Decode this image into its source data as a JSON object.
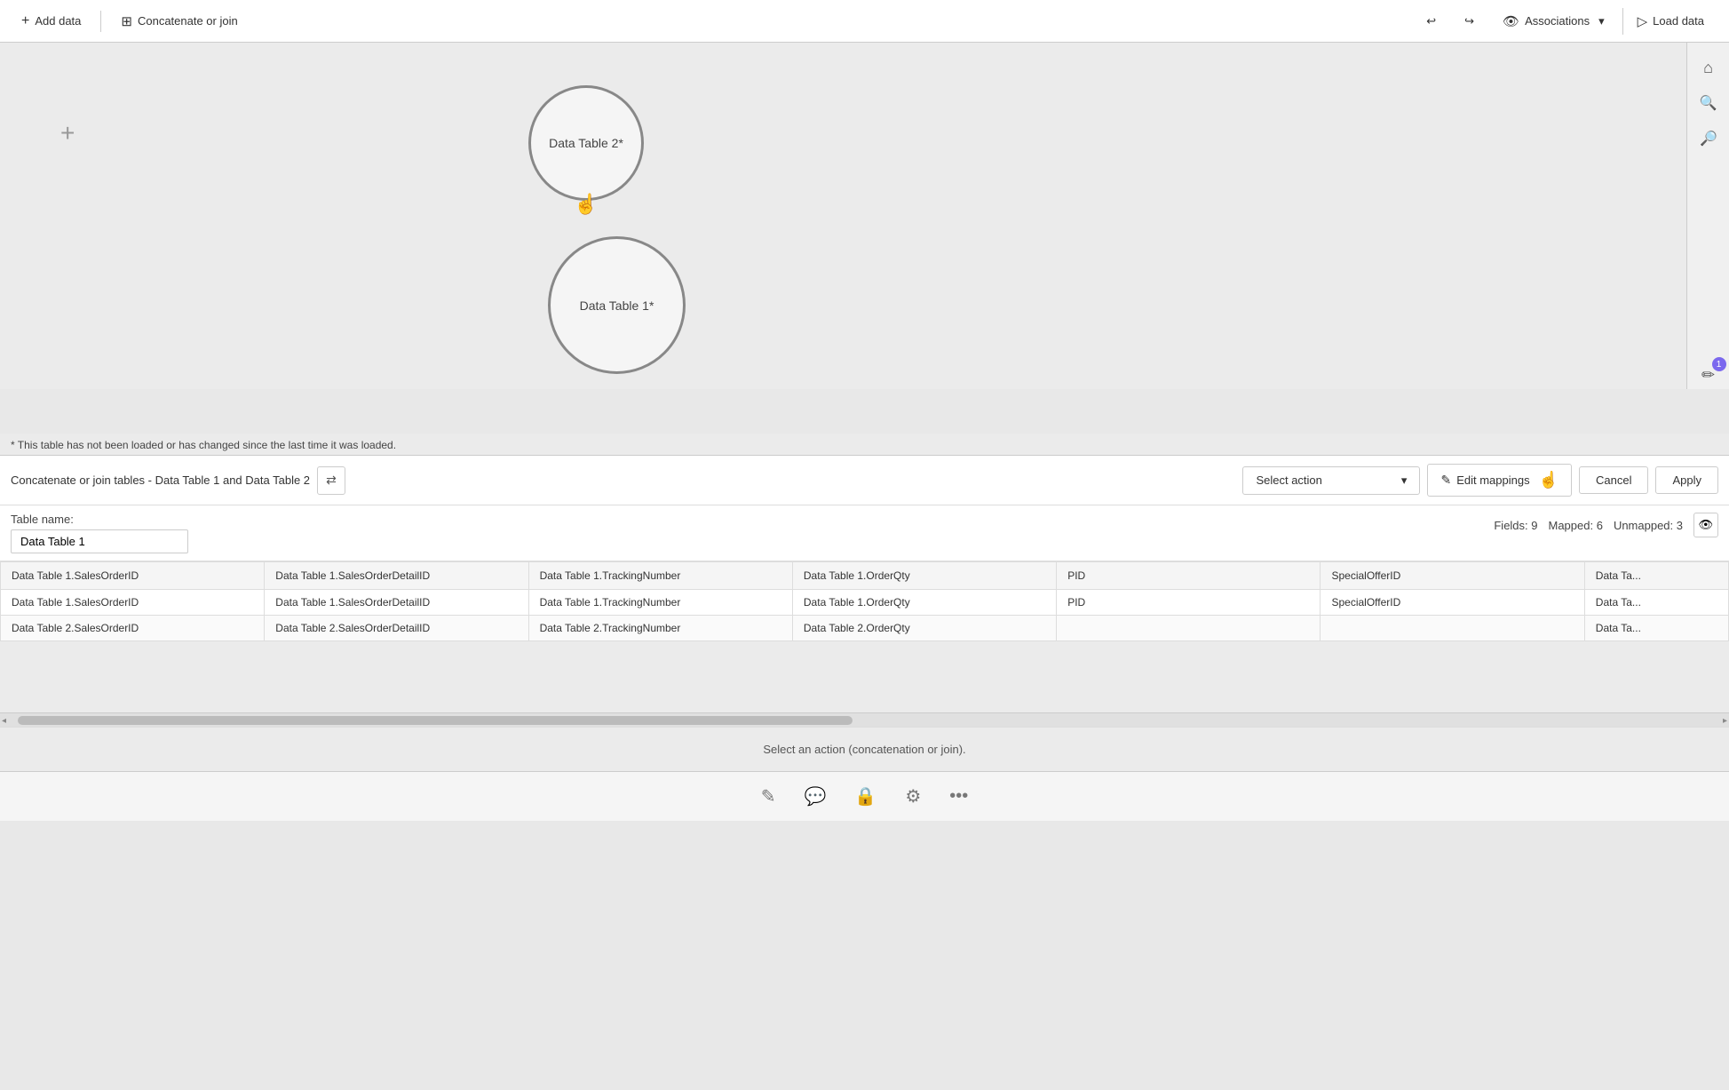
{
  "toolbar": {
    "add_data_label": "Add data",
    "concatenate_join_label": "Concatenate or join",
    "associations_label": "Associations",
    "load_data_label": "Load data",
    "undo_icon": "↩",
    "redo_icon": "↪",
    "chevron_down": "▾"
  },
  "canvas": {
    "table_node_2_label": "Data Table 2*",
    "table_node_1_label": "Data Table 1*",
    "plus_icon": "+"
  },
  "sidebar_icons": {
    "home": "⌂",
    "zoom_in": "🔍",
    "zoom_out": "🔍",
    "notification_count": "1",
    "pencil": "✏"
  },
  "warning": {
    "text": "* This table has not been loaded or has changed since the last time it was loaded."
  },
  "bottom_panel": {
    "title": "Concatenate or join tables - Data Table 1 and Data Table 2",
    "swap_icon": "⇄",
    "select_action_label": "Select action",
    "edit_mappings_label": "Edit mappings",
    "cancel_label": "Cancel",
    "apply_label": "Apply",
    "table_name_label": "Table name:",
    "table_name_value": "Data Table 1",
    "fields_label": "Fields: 9",
    "mapped_label": "Mapped: 6",
    "unmapped_label": "Unmapped: 3"
  },
  "table": {
    "headers": [
      "Data Table 1.SalesOrderID",
      "Data Table 1.SalesOrderDetailID",
      "Data Table 1.TrackingNumber",
      "Data Table 1.OrderQty",
      "PID",
      "SpecialOfferID",
      "Data Ta..."
    ],
    "rows": [
      {
        "col1": "Data Table 1.SalesOrderID",
        "col2": "Data Table 1.SalesOrderDetailID",
        "col3": "Data Table 1.TrackingNumber",
        "col4": "Data Table 1.OrderQty",
        "col5": "PID",
        "col6": "SpecialOfferID",
        "col7": "Data Ta...",
        "col5_empty": false,
        "col6_empty": false
      },
      {
        "col1": "Data Table 2.SalesOrderID",
        "col2": "Data Table 2.SalesOrderDetailID",
        "col3": "Data Table 2.TrackingNumber",
        "col4": "Data Table 2.OrderQty",
        "col5": "",
        "col6": "",
        "col7": "Data Ta...",
        "col5_empty": true,
        "col6_empty": true
      }
    ]
  },
  "status": {
    "message": "Select an action (concatenation or join)."
  },
  "bottom_nav": {
    "icons": [
      "✎",
      "💬",
      "🔒",
      "⚙",
      "•••"
    ]
  }
}
